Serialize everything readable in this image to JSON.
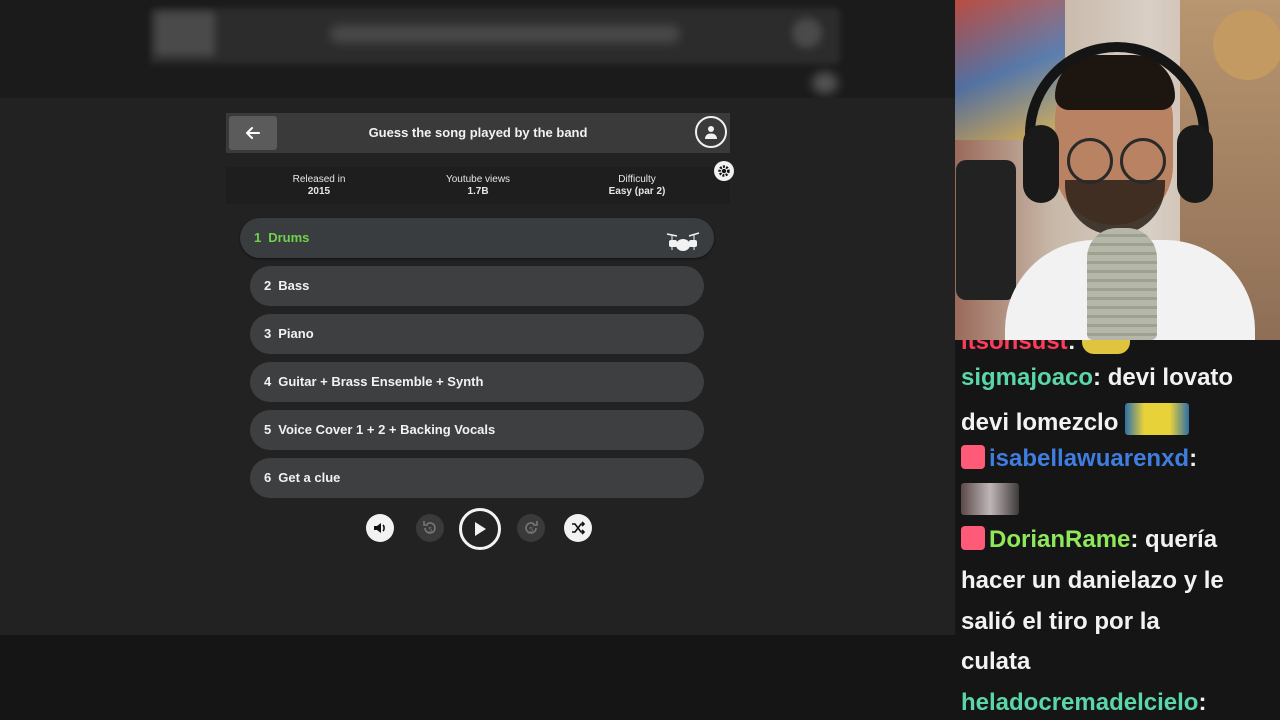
{
  "game": {
    "title": "Guess the song played by the band",
    "info": [
      {
        "label": "Released in",
        "value": "2015"
      },
      {
        "label": "Youtube views",
        "value": "1.7B"
      },
      {
        "label": "Difficulty",
        "value": "Easy (par 2)"
      }
    ],
    "tracks": [
      {
        "num": "1",
        "label": "Drums",
        "active": true
      },
      {
        "num": "2",
        "label": "Bass"
      },
      {
        "num": "3",
        "label": "Piano"
      },
      {
        "num": "4",
        "label": "Guitar + Brass Ensemble + Synth"
      },
      {
        "num": "5",
        "label": "Voice Cover 1 + 2 + Backing Vocals"
      },
      {
        "num": "6",
        "label": "Get a clue"
      }
    ],
    "controls": [
      "volume-icon",
      "rewind-5-icon",
      "play-icon",
      "forward-5-icon",
      "shuffle-icon"
    ]
  },
  "chat": {
    "lines": [
      {
        "user": "itsonsust",
        "text": ""
      },
      {
        "user": "sigmajoaco",
        "text": "devi lovato"
      },
      {
        "user": "",
        "text": "devi lomezclo"
      },
      {
        "user": "isabellawuarenxd",
        "text": ""
      },
      {
        "user": "DorianRame",
        "text": "quería"
      },
      {
        "user": "",
        "text": "hacer un danielazo y le"
      },
      {
        "user": "",
        "text": "salió el tiro por la"
      },
      {
        "user": "",
        "text": "culata"
      },
      {
        "user": "heladocremadelcielo",
        "text": ""
      }
    ]
  },
  "colors": {
    "active_track": "#6fd24b",
    "panel": "#222222",
    "track_bg": "#3d3f41"
  }
}
